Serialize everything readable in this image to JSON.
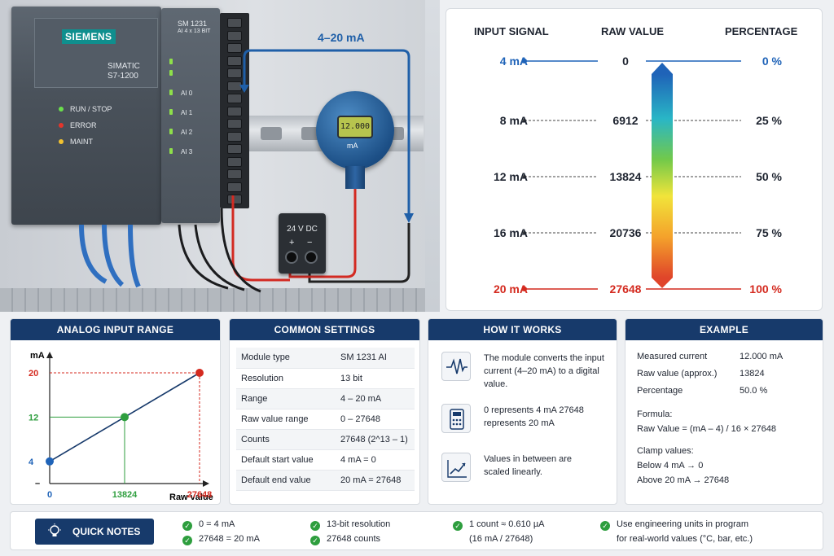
{
  "photo": {
    "brand": "SIEMENS",
    "cpu_model_line1": "SIMATIC",
    "cpu_model_line2": "S7-1200",
    "leds": [
      {
        "label": "RUN / STOP",
        "color": "#6be04c"
      },
      {
        "label": "ERROR",
        "color": "#e5352b"
      },
      {
        "label": "MAINT",
        "color": "#f2c230"
      }
    ],
    "module_line1": "SM 1231",
    "module_line2": "AI 4 x 13 BIT",
    "ai_channels": [
      "AI 0",
      "AI 1",
      "AI 2",
      "AI 3"
    ],
    "loop_label": "4–20 mA",
    "transmitter_display": "12.000",
    "transmitter_unit": "mA",
    "psu_label": "24 V DC",
    "psu_plus": "+",
    "psu_minus": "−"
  },
  "range_table": {
    "headers": {
      "input": "INPUT SIGNAL",
      "raw": "RAW VALUE",
      "pct": "PERCENTAGE"
    },
    "rows": [
      {
        "input": "4 mA",
        "raw": "0",
        "pct": "0 %"
      },
      {
        "input": "8 mA",
        "raw": "6912",
        "pct": "25 %"
      },
      {
        "input": "12 mA",
        "raw": "13824",
        "pct": "50 %"
      },
      {
        "input": "16 mA",
        "raw": "20736",
        "pct": "75 %"
      },
      {
        "input": "20 mA",
        "raw": "27648",
        "pct": "100 %"
      }
    ],
    "colors": {
      "low": "#1f63b8",
      "high": "#d42a1f",
      "text": "#1e2430"
    }
  },
  "analog_range": {
    "title": "ANALOG INPUT RANGE",
    "y_axis_label": "mA",
    "x_axis_label": "Raw value",
    "y_ticks": [
      "4",
      "12",
      "20"
    ],
    "x_ticks": [
      "0",
      "13824",
      "27648"
    ],
    "zero_dash": "–"
  },
  "chart_data": {
    "type": "line",
    "title": "ANALOG INPUT RANGE",
    "xlabel": "Raw value",
    "ylabel": "mA",
    "x": [
      0,
      13824,
      27648
    ],
    "y": [
      4,
      12,
      20
    ],
    "xlim": [
      0,
      27648
    ],
    "ylim": [
      0,
      20
    ],
    "point_colors": [
      "#1f63b8",
      "#2e9e3e",
      "#d42a1f"
    ],
    "grid": false
  },
  "settings": {
    "title": "COMMON SETTINGS",
    "rows": [
      {
        "key": "Module type",
        "value": "SM 1231 AI"
      },
      {
        "key": "Resolution",
        "value": "13 bit"
      },
      {
        "key": "Range",
        "value": "4 – 20 mA"
      },
      {
        "key": "Raw value range",
        "value": "0 – 27648"
      },
      {
        "key": "Counts",
        "value": "27648 (2^13 – 1)"
      },
      {
        "key": "Default start value",
        "value": "4 mA = 0"
      },
      {
        "key": "Default end value",
        "value": "20 mA = 27648"
      }
    ]
  },
  "how": {
    "title": "HOW IT WORKS",
    "items": [
      {
        "icon": "waveform-icon",
        "text": "The module converts the input current (4–20 mA) to a digital value."
      },
      {
        "icon": "calculator-icon",
        "text": "0 represents 4 mA 27648 represents 20 mA"
      },
      {
        "icon": "trend-chart-icon",
        "text": "Values in between are scaled linearly."
      }
    ]
  },
  "example": {
    "title": "EXAMPLE",
    "rows": [
      {
        "label": "Measured current",
        "value": "12.000 mA"
      },
      {
        "label": "Raw value (approx.)",
        "value": "13824"
      },
      {
        "label": "Percentage",
        "value": "50.0 %"
      }
    ],
    "formula_label": "Formula:",
    "formula": "Raw Value = (mA – 4) / 16 × 27648",
    "clamp_label": "Clamp values:",
    "clamp_low": "Below 4 mA  →  0",
    "clamp_high": "Above 20 mA  →  27648"
  },
  "notes": {
    "title": "QUICK NOTES",
    "items": [
      {
        "line1": "0 = 4 mA",
        "line2": "27648 = 20 mA"
      },
      {
        "line1": "13-bit resolution",
        "line2": "27648 counts"
      },
      {
        "line1": "1 count ≈ 0.610 µA",
        "line2": "(16 mA / 27648)"
      },
      {
        "line1": "Use engineering units in program",
        "line2": "for real-world values (°C, bar, etc.)"
      }
    ],
    "check_color": "#2e9e3e"
  }
}
